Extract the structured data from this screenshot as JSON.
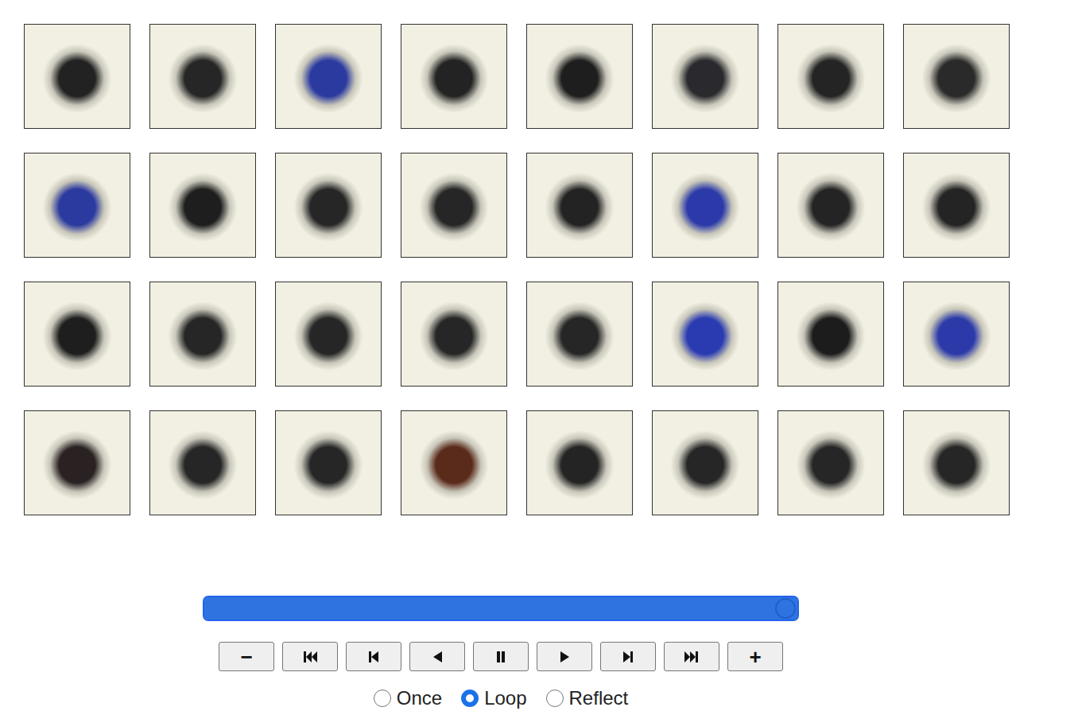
{
  "frames": [
    {
      "color": "#222222"
    },
    {
      "color": "#262626"
    },
    {
      "color": "#2b3a9e"
    },
    {
      "color": "#232323"
    },
    {
      "color": "#1e1e1e"
    },
    {
      "color": "#2a2a2e"
    },
    {
      "color": "#242424"
    },
    {
      "color": "#2a2a2a"
    },
    {
      "color": "#2b3a9e"
    },
    {
      "color": "#1e1e1e"
    },
    {
      "color": "#262626"
    },
    {
      "color": "#262626"
    },
    {
      "color": "#232323"
    },
    {
      "color": "#2b3aa8"
    },
    {
      "color": "#242424"
    },
    {
      "color": "#242424"
    },
    {
      "color": "#1e1e1e"
    },
    {
      "color": "#262626"
    },
    {
      "color": "#262626"
    },
    {
      "color": "#262626"
    },
    {
      "color": "#262626"
    },
    {
      "color": "#2a3ab0"
    },
    {
      "color": "#1c1c1c"
    },
    {
      "color": "#2b3aa8"
    },
    {
      "color": "#2a2222"
    },
    {
      "color": "#262626"
    },
    {
      "color": "#262626"
    },
    {
      "color": "#5a2a1a"
    },
    {
      "color": "#242424"
    },
    {
      "color": "#262626"
    },
    {
      "color": "#262626"
    },
    {
      "color": "#262626"
    }
  ],
  "slider": {
    "level": 1
  },
  "buttons": [
    {
      "kind": "text",
      "label": "−"
    },
    {
      "kind": "first"
    },
    {
      "kind": "prev"
    },
    {
      "kind": "reverse"
    },
    {
      "kind": "pause"
    },
    {
      "kind": "play"
    },
    {
      "kind": "next"
    },
    {
      "kind": "last"
    },
    {
      "kind": "text",
      "label": "+"
    }
  ],
  "modes": [
    {
      "label": "Once",
      "selected": false
    },
    {
      "label": "Loop",
      "selected": true
    },
    {
      "label": "Reflect",
      "selected": false
    }
  ]
}
